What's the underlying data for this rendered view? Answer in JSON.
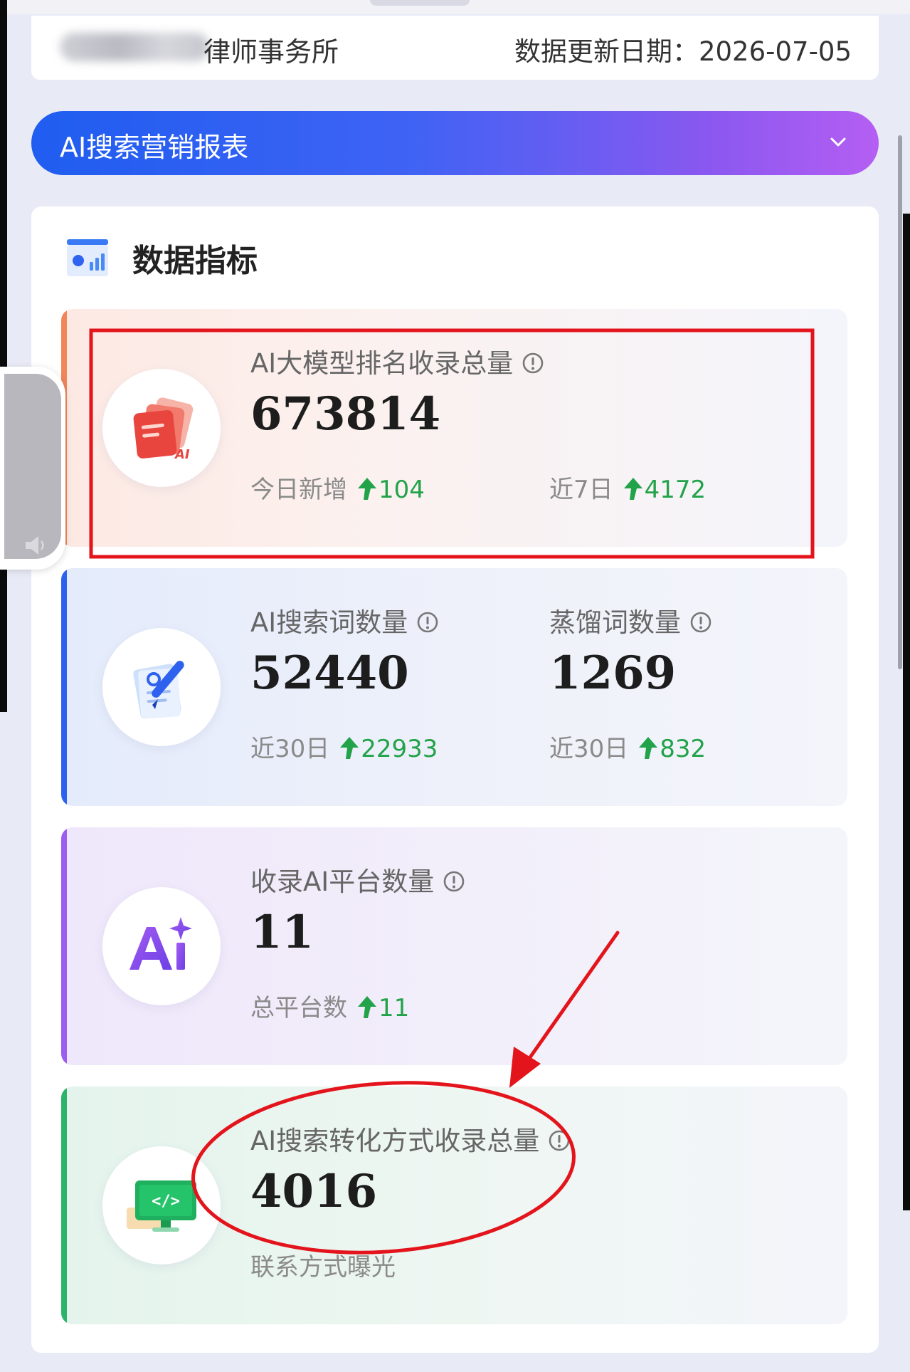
{
  "header": {
    "firm_suffix": "律师事务所",
    "update_date": "数据更新日期：2026-07-05"
  },
  "report_selector": {
    "title": "AI搜索营销报表"
  },
  "panel": {
    "title": "数据指标"
  },
  "metrics": {
    "ranking": {
      "label": "AI大模型排名收录总量",
      "value": "673814",
      "today_label": "今日新增",
      "today_delta": "104",
      "week_label": "近7日",
      "week_delta": "4172"
    },
    "search_words": {
      "label": "AI搜索词数量",
      "value": "52440",
      "sub_label": "近30日",
      "delta": "22933"
    },
    "distilled_words": {
      "label": "蒸馏词数量",
      "value": "1269",
      "sub_label": "近30日",
      "delta": "832"
    },
    "platforms": {
      "label": "收录AI平台数量",
      "value": "11",
      "sub_label": "总平台数",
      "delta": "11"
    },
    "conversion": {
      "label": "AI搜索转化方式收录总量",
      "value": "4016",
      "sub_label": "联系方式曝光"
    }
  },
  "icons": {
    "ranking": "documents-ai-icon",
    "search_words": "note-pen-icon",
    "platforms": "ai-sparkle-icon",
    "conversion": "monitor-code-icon"
  },
  "colors": {
    "accent_orange": "#f0875a",
    "accent_blue": "#2e62ee",
    "accent_purple": "#9b5cf0",
    "accent_green": "#2bb46a",
    "delta_green": "#22a34a",
    "annotation_red": "#e3141b"
  }
}
